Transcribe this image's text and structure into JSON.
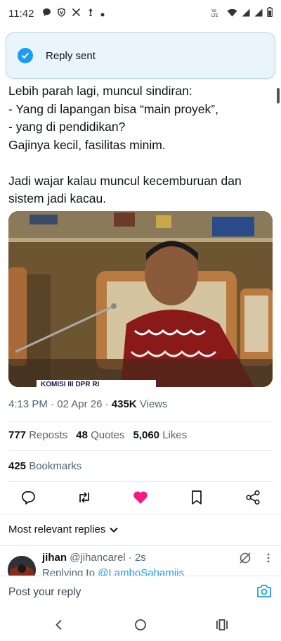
{
  "status_bar": {
    "time": "11:42",
    "network_label": "VoLTE"
  },
  "toast": {
    "text": "Reply sent"
  },
  "tweet": {
    "text": "Lebih parah lagi, muncul sindiran:\n- Yang di lapangan bisa “main proyek”,\n- yang di pendidikan?\nGajinya kecil, fasilitas minim.\n\nJadi wajar kalau muncul kecemburuan dan sistem jadi kacau.",
    "media_caption": "KOMISI III DPR RI",
    "time": "4:13 PM",
    "date": "02 Apr 26",
    "views_count": "435K",
    "views_label": "Views",
    "reposts_count": "777",
    "reposts_label": "Reposts",
    "quotes_count": "48",
    "quotes_label": "Quotes",
    "likes_count": "5,060",
    "likes_label": "Likes",
    "bookmarks_count": "425",
    "bookmarks_label": "Bookmarks"
  },
  "actions": {
    "icons": [
      "reply-icon",
      "repost-icon",
      "like-icon",
      "bookmark-icon",
      "share-icon"
    ],
    "like_color": "#f91880",
    "icon_color": "#536471"
  },
  "replies": {
    "sort_label": "Most relevant replies",
    "items": [
      {
        "name": "jihan",
        "handle": "@jihancarel",
        "time": "2s",
        "replying_prefix": "Replying to",
        "replying_to": "@LamboSahamjis"
      }
    ]
  },
  "compose": {
    "placeholder": "Post your reply"
  },
  "colors": {
    "accent": "#1d9bf0",
    "toast_bg": "#eaf5fb",
    "text_primary": "#0f1419",
    "text_secondary": "#536471"
  }
}
